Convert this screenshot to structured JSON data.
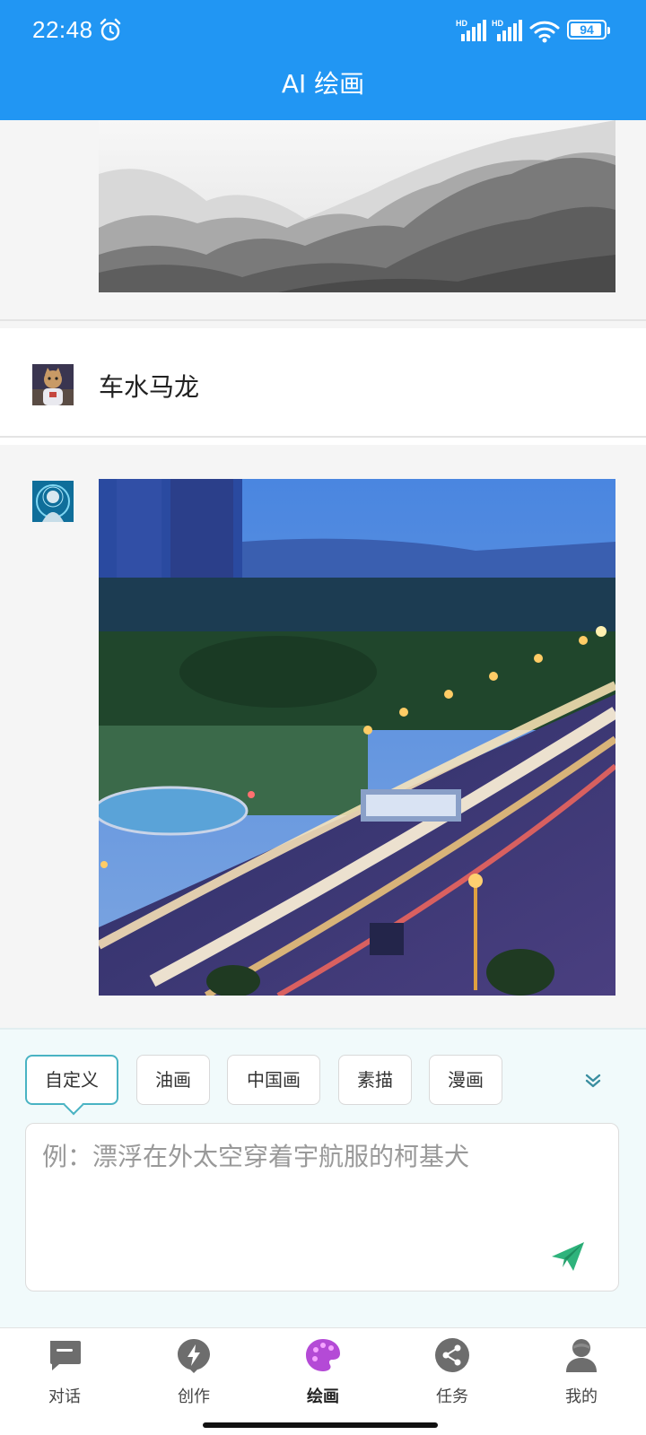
{
  "status_bar": {
    "time": "22:48",
    "signal1_label": "HD",
    "signal2_label": "HD",
    "battery": "94",
    "battery_level": 0.94
  },
  "header": {
    "title": "AI 绘画"
  },
  "chat": {
    "user_message": "车水马龙"
  },
  "styles": {
    "chips": [
      "自定义",
      "油画",
      "中国画",
      "素描",
      "漫画"
    ],
    "selected": "自定义"
  },
  "prompt": {
    "placeholder": "例：漂浮在外太空穿着宇航服的柯基犬",
    "value": ""
  },
  "nav": {
    "items": [
      {
        "label": "对话",
        "icon": "chat-icon"
      },
      {
        "label": "创作",
        "icon": "lightning-icon"
      },
      {
        "label": "绘画",
        "icon": "palette-icon"
      },
      {
        "label": "任务",
        "icon": "share-icon"
      },
      {
        "label": "我的",
        "icon": "profile-icon"
      }
    ],
    "active": "绘画"
  },
  "colors": {
    "header_bg": "#2196f3",
    "accent": "#49b3c3",
    "send": "#2fb37c",
    "palette": "#b44ad6"
  }
}
